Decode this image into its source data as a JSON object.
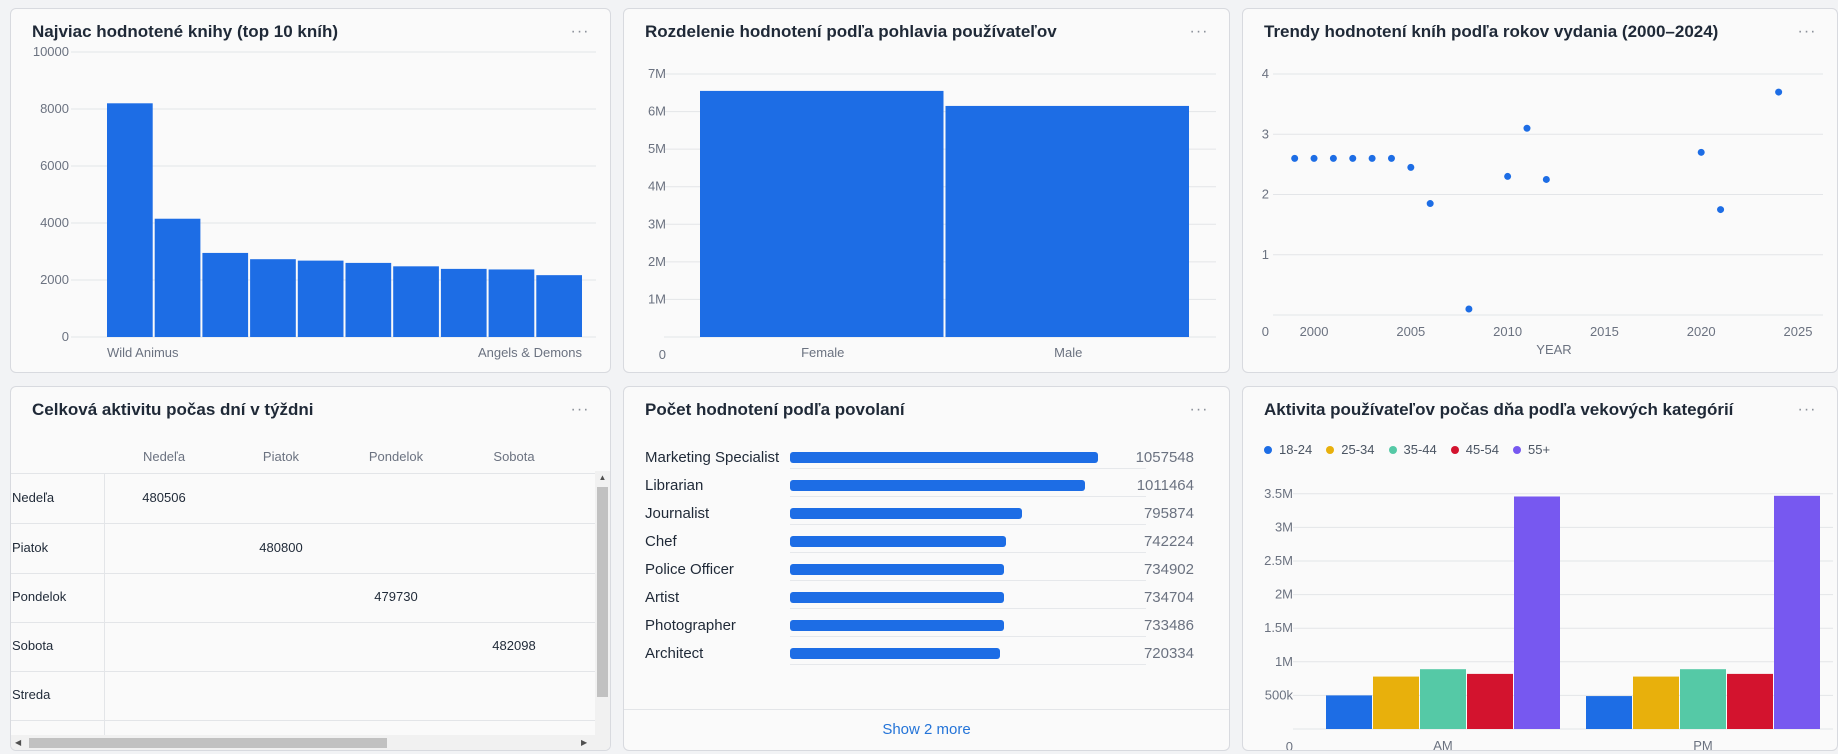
{
  "panels": {
    "top_books": {
      "title": "Najviac hodnotené knihy (top 10 kníh)",
      "chart_data": {
        "type": "bar",
        "categories": [
          "Wild Animus",
          "",
          "",
          "",
          "",
          "",
          "",
          "",
          "",
          "Angels & Demons"
        ],
        "values": [
          8200,
          4150,
          2950,
          2730,
          2680,
          2600,
          2480,
          2390,
          2370,
          2170
        ],
        "y_ticks": [
          "0",
          "2000",
          "4000",
          "6000",
          "8000",
          "10000"
        ],
        "ylim": [
          0,
          10000
        ],
        "color": "#1d6de5"
      }
    },
    "gender": {
      "title": "Rozdelenie hodnotení podľa pohlavia používateľov",
      "chart_data": {
        "type": "bar",
        "categories": [
          "Female",
          "Male"
        ],
        "values": [
          6550000,
          6150000
        ],
        "y_ticks": [
          "0",
          "1M",
          "2M",
          "3M",
          "4M",
          "5M",
          "6M",
          "7M"
        ],
        "ylim": [
          0,
          7000000
        ],
        "color": "#1d6de5"
      }
    },
    "trend": {
      "title": "Trendy hodnotení kníh podľa rokov vydania (2000–2024)",
      "chart_data": {
        "type": "scatter",
        "xlabel": "YEAR",
        "x": [
          1999,
          2000,
          2001,
          2002,
          2003,
          2004,
          2005,
          2006,
          2008,
          2010,
          2011,
          2012,
          2020,
          2021,
          2024
        ],
        "y": [
          2.6,
          2.6,
          2.6,
          2.6,
          2.6,
          2.6,
          2.45,
          1.85,
          0.1,
          2.3,
          3.1,
          2.25,
          2.7,
          1.75,
          3.7
        ],
        "x_ticks": [
          "2000",
          "2005",
          "2010",
          "2015",
          "2020",
          "2025"
        ],
        "y_ticks": [
          "0",
          "1",
          "2",
          "3",
          "4"
        ],
        "xlim": [
          1998.5,
          2025
        ],
        "ylim": [
          0,
          4
        ],
        "color": "#1d6de5"
      }
    },
    "weekday": {
      "title": "Celková aktivitu počas dní v týždni",
      "columns": [
        "Nedeľa",
        "Piatok",
        "Pondelok",
        "Sobota"
      ],
      "rows": [
        {
          "label": "Nedeľa",
          "values": [
            "480506",
            "",
            "",
            ""
          ]
        },
        {
          "label": "Piatok",
          "values": [
            "",
            "480800",
            "",
            ""
          ]
        },
        {
          "label": "Pondelok",
          "values": [
            "",
            "",
            "479730",
            ""
          ]
        },
        {
          "label": "Sobota",
          "values": [
            "",
            "",
            "",
            "482098"
          ]
        },
        {
          "label": "Streda",
          "values": [
            "",
            "",
            "",
            ""
          ]
        }
      ]
    },
    "occupation": {
      "title": "Počet hodnotení podľa povolaní",
      "items": [
        {
          "label": "Marketing Specialist",
          "value": "1057548",
          "num": 1057548
        },
        {
          "label": "Librarian",
          "value": "1011464",
          "num": 1011464
        },
        {
          "label": "Journalist",
          "value": "795874",
          "num": 795874
        },
        {
          "label": "Chef",
          "value": "742224",
          "num": 742224
        },
        {
          "label": "Police Officer",
          "value": "734902",
          "num": 734902
        },
        {
          "label": "Artist",
          "value": "734704",
          "num": 734704
        },
        {
          "label": "Photographer",
          "value": "733486",
          "num": 733486
        },
        {
          "label": "Architect",
          "value": "720334",
          "num": 720334
        }
      ],
      "show_more": "Show 2 more"
    },
    "age": {
      "title": "Aktivita používateľov počas dňa podľa vekových kategórií",
      "chart_data": {
        "type": "bar",
        "categories": [
          "AM",
          "PM"
        ],
        "series": [
          {
            "name": "18-24",
            "color": "#1d6de5",
            "values": [
              500000,
              490000
            ]
          },
          {
            "name": "25-34",
            "color": "#e8b00c",
            "values": [
              780000,
              780000
            ]
          },
          {
            "name": "35-44",
            "color": "#55c9a6",
            "values": [
              890000,
              890000
            ]
          },
          {
            "name": "45-54",
            "color": "#d3132e",
            "values": [
              820000,
              820000
            ]
          },
          {
            "name": "55+",
            "color": "#7758f0",
            "values": [
              3460000,
              3470000
            ]
          }
        ],
        "y_ticks": [
          "0",
          "500k",
          "1M",
          "1.5M",
          "2M",
          "2.5M",
          "3M",
          "3.5M"
        ],
        "ylim": [
          0,
          3750000
        ]
      }
    }
  },
  "menu_glyph": "···"
}
